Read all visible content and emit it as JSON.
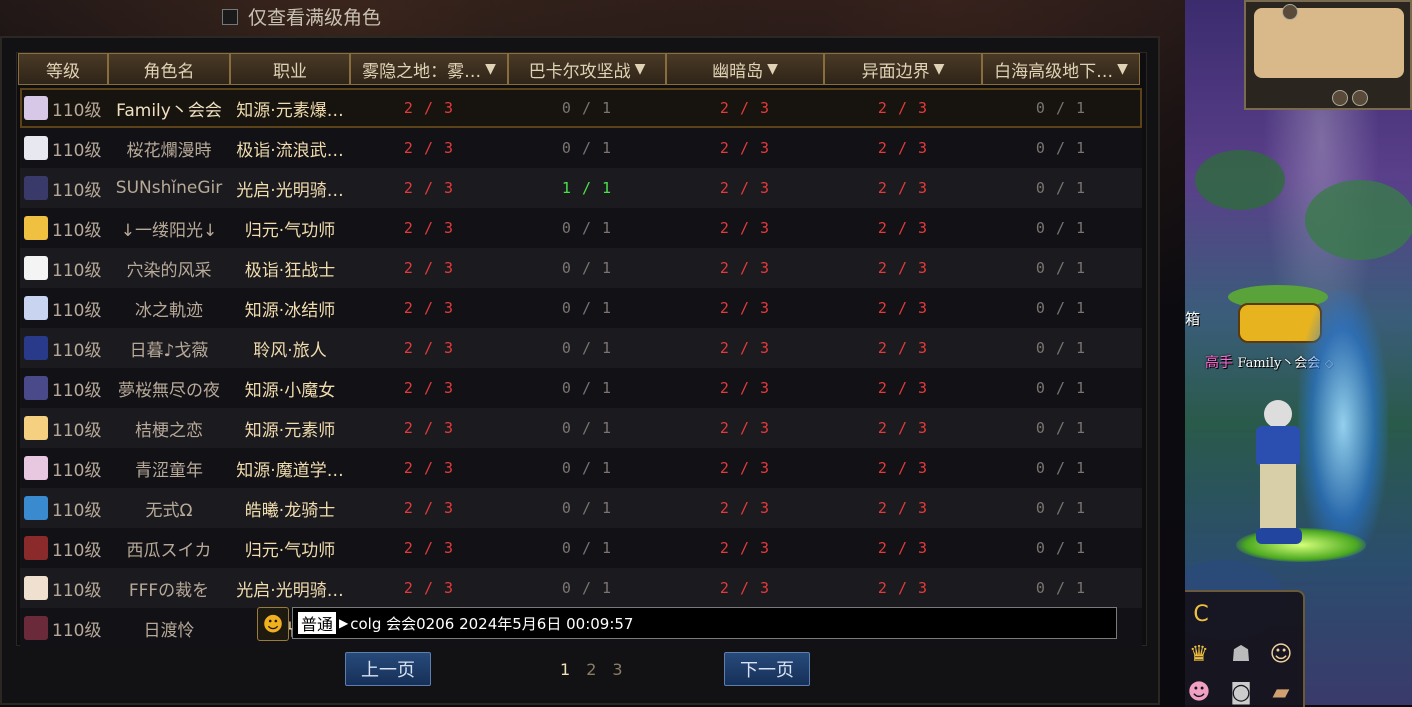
{
  "filter": {
    "label": "仅查看满级角色",
    "checked": false
  },
  "columns": [
    {
      "label": "等级",
      "dropdown": false
    },
    {
      "label": "角色名",
      "dropdown": false
    },
    {
      "label": "职业",
      "dropdown": false
    },
    {
      "label": "雾隐之地：雾…",
      "dropdown": true
    },
    {
      "label": "巴卡尔攻坚战",
      "dropdown": true
    },
    {
      "label": "幽暗岛",
      "dropdown": true
    },
    {
      "label": "异面边界",
      "dropdown": true
    },
    {
      "label": "白海高级地下…",
      "dropdown": true
    }
  ],
  "rows": [
    {
      "level": "110级",
      "name": "Family丶会会",
      "job": "知源·元素爆…",
      "d1": "2 / 3",
      "d2": "0 / 1",
      "d3": "2 / 3",
      "d4": "2 / 3",
      "d5": "0 / 1",
      "avatar": "#d8c8e8"
    },
    {
      "level": "110级",
      "name": "桜花爛漫時",
      "job": "极诣·流浪武…",
      "d1": "2 / 3",
      "d2": "0 / 1",
      "d3": "2 / 3",
      "d4": "2 / 3",
      "d5": "0 / 1",
      "avatar": "#e8e8f0"
    },
    {
      "level": "110级",
      "name": "SUNshǐneGir",
      "job": "光启·光明骑…",
      "d1": "2 / 3",
      "d2": "1 / 1",
      "d3": "2 / 3",
      "d4": "2 / 3",
      "d5": "0 / 1",
      "avatar": "#3a3a6a"
    },
    {
      "level": "110级",
      "name": "↓一缕阳光↓",
      "job": "归元·气功师",
      "d1": "2 / 3",
      "d2": "0 / 1",
      "d3": "2 / 3",
      "d4": "2 / 3",
      "d5": "0 / 1",
      "avatar": "#f0c040"
    },
    {
      "level": "110级",
      "name": "穴染的风采",
      "job": "极诣·狂战士",
      "d1": "2 / 3",
      "d2": "0 / 1",
      "d3": "2 / 3",
      "d4": "2 / 3",
      "d5": "0 / 1",
      "avatar": "#f4f4f4"
    },
    {
      "level": "110级",
      "name": "冰之軌迹",
      "job": "知源·冰结师",
      "d1": "2 / 3",
      "d2": "0 / 1",
      "d3": "2 / 3",
      "d4": "2 / 3",
      "d5": "0 / 1",
      "avatar": "#c8d4f0"
    },
    {
      "level": "110级",
      "name": "日暮♪戈薇",
      "job": "聆风·旅人",
      "d1": "2 / 3",
      "d2": "0 / 1",
      "d3": "2 / 3",
      "d4": "2 / 3",
      "d5": "0 / 1",
      "avatar": "#2a3a8a"
    },
    {
      "level": "110级",
      "name": "夢桜無尽の夜",
      "job": "知源·小魔女",
      "d1": "2 / 3",
      "d2": "0 / 1",
      "d3": "2 / 3",
      "d4": "2 / 3",
      "d5": "0 / 1",
      "avatar": "#4a4a8a"
    },
    {
      "level": "110级",
      "name": "桔梗之恋",
      "job": "知源·元素师",
      "d1": "2 / 3",
      "d2": "0 / 1",
      "d3": "2 / 3",
      "d4": "2 / 3",
      "d5": "0 / 1",
      "avatar": "#f4d080"
    },
    {
      "level": "110级",
      "name": "青涩童年",
      "job": "知源·魔道学…",
      "d1": "2 / 3",
      "d2": "0 / 1",
      "d3": "2 / 3",
      "d4": "2 / 3",
      "d5": "0 / 1",
      "avatar": "#e8c8e0"
    },
    {
      "level": "110级",
      "name": "无式Ω",
      "job": "皓曦·龙骑士",
      "d1": "2 / 3",
      "d2": "0 / 1",
      "d3": "2 / 3",
      "d4": "2 / 3",
      "d5": "0 / 1",
      "avatar": "#3a8ad0"
    },
    {
      "level": "110级",
      "name": "西瓜スイカ",
      "job": "归元·气功师",
      "d1": "2 / 3",
      "d2": "0 / 1",
      "d3": "2 / 3",
      "d4": "2 / 3",
      "d5": "0 / 1",
      "avatar": "#8a2a2a"
    },
    {
      "level": "110级",
      "name": "FFFの裁を",
      "job": "光启·光明骑…",
      "d1": "2 / 3",
      "d2": "0 / 1",
      "d3": "2 / 3",
      "d4": "2 / 3",
      "d5": "0 / 1",
      "avatar": "#f0e0d0"
    },
    {
      "level": "110级",
      "name": "日渡怜",
      "job": "光",
      "d1": "",
      "d2": "",
      "d3": "",
      "d4": "",
      "d5": "",
      "avatar": "#6a2a3a"
    }
  ],
  "chat": {
    "channel": "普通",
    "text": "colg 会会0206 2024年5月6日 00:09:57"
  },
  "pagination": {
    "prev": "上一页",
    "next": "下一页",
    "pages": [
      "1",
      "2",
      "3"
    ],
    "current": "1"
  },
  "scene": {
    "player_title": "高手",
    "player_name": "Family丶会会",
    "side_text": "箱"
  },
  "colors": {
    "accent_red": "#e43a3a",
    "accent_green": "#4be04b",
    "muted": "#7a7470",
    "header_gold": "#8a6d3d"
  }
}
